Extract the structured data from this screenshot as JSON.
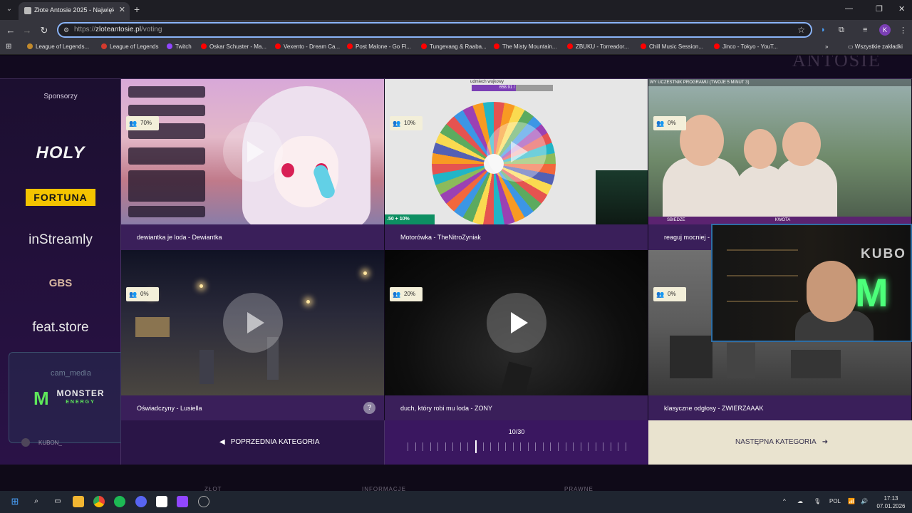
{
  "browser": {
    "tab_title": "Złote Antosie 2025 - Największa",
    "url_protocol": "https://",
    "url_host": "zloteantosie.pl",
    "url_path": "/voting",
    "new_tab": "+",
    "profile_initial": "K"
  },
  "bookmarks": [
    {
      "label": "League of Legends...",
      "color": "#c28a2c"
    },
    {
      "label": "League of Legends",
      "color": "#d33a2e"
    },
    {
      "label": "Twitch",
      "color": "#9146ff"
    },
    {
      "label": "Oskar Schuster - Ma...",
      "color": "#ff0000"
    },
    {
      "label": "Vexento - Dream Ca...",
      "color": "#ff0000"
    },
    {
      "label": "Post Malone - Go Fl...",
      "color": "#ff0000"
    },
    {
      "label": "Tungevaag & Raaba...",
      "color": "#ff0000"
    },
    {
      "label": "The Misty Mountain...",
      "color": "#ff0000"
    },
    {
      "label": "ZBUKU - Torreador...",
      "color": "#ff0000"
    },
    {
      "label": "Chill Music Session...",
      "color": "#ff0000"
    },
    {
      "label": "Jinco - Tokyo - YouT...",
      "color": "#ff0000"
    }
  ],
  "bookmarks_more": "»",
  "bookmarks_all": "Wszystkie zakładki",
  "sidebar": {
    "title": "Sponsorzy",
    "sponsors": [
      "HOLY",
      "FORTUNA",
      "inStreamly",
      "GBS",
      "feat.store"
    ],
    "cam_media": "cam_media",
    "monster_word": "MONSTER",
    "monster_sub": "ENERGY",
    "username": "KUBON_"
  },
  "videos": [
    {
      "percent": "70%",
      "title": "dewiantka je loda - Dewiantka"
    },
    {
      "percent": "10%",
      "title": "Motorówka - TheNitroZyniak"
    },
    {
      "percent": "0%",
      "title": "reaguj mocniej -"
    },
    {
      "percent": "0%",
      "title": "Oświadczyny - Lusiella"
    },
    {
      "percent": "20%",
      "title": "duch, który robi mu loda - ZONY"
    },
    {
      "percent": "0%",
      "title": "klasyczne odgłosy - ZWIERZAAAK"
    }
  ],
  "thumb_text": {
    "wheel_title": "udmiech wujkowy",
    "wheel_bar": "658.91 / 1120",
    "green_promo": ".50 + 10%",
    "stream_strip": "WY UCZESTNIK PROGRAMU (TWOJE 5 MINUT 3)",
    "strip_left": "SBIEDZE",
    "strip_right": "KWOTA",
    "webcam_text": "KUBO"
  },
  "help_badge": "?",
  "navigation": {
    "prev_label": "POPRZEDNIA KATEGORIA",
    "next_label": "NASTĘPNA KATEGORIA",
    "progress": "10/30",
    "current": 10,
    "total": 30
  },
  "taskbar": {
    "lang": "POL",
    "time": "17:13",
    "date": "07.01.2026"
  },
  "colors": {
    "accent_purple": "#3a1f5a",
    "next_bg": "#e9e3cf",
    "percent_badge": "#f3efd9",
    "omnibox_focus": "#8ab4f8"
  }
}
